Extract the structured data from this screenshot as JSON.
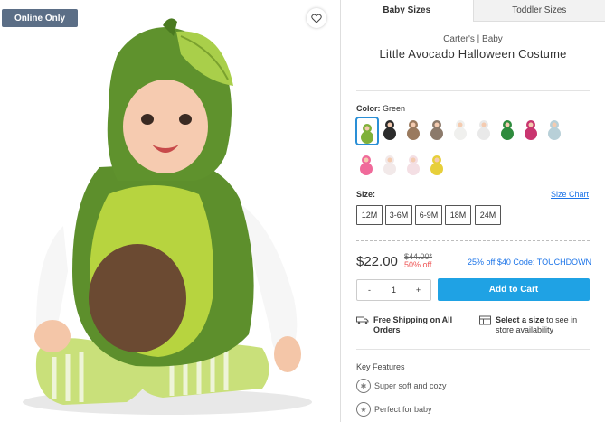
{
  "image": {
    "badge": "Online Only"
  },
  "tabs": [
    {
      "label": "Baby Sizes"
    },
    {
      "label": "Toddler Sizes"
    }
  ],
  "product": {
    "brand": "Carter's | Baby",
    "title": "Little Avocado Halloween Costume"
  },
  "color": {
    "label": "Color:",
    "value": "Green",
    "swatches": [
      {
        "name": "avocado",
        "color": "#7fb13a"
      },
      {
        "name": "penguin",
        "color": "#2b2b2b"
      },
      {
        "name": "monkey",
        "color": "#9a7a5e"
      },
      {
        "name": "sloth",
        "color": "#8c7a6b"
      },
      {
        "name": "chicken",
        "color": "#f0f0ee"
      },
      {
        "name": "cow",
        "color": "#e9e9e9"
      },
      {
        "name": "dinosaur",
        "color": "#2e8b3d"
      },
      {
        "name": "panda-pink",
        "color": "#c9356f"
      },
      {
        "name": "shark",
        "color": "#b8d0d8"
      },
      {
        "name": "flamingo",
        "color": "#f06a9a"
      },
      {
        "name": "bunny",
        "color": "#f2e9e9"
      },
      {
        "name": "unicorn",
        "color": "#f4dfe4"
      },
      {
        "name": "giraffe",
        "color": "#e7cf3a"
      }
    ]
  },
  "size": {
    "label": "Size:",
    "chart_link": "Size Chart",
    "options": [
      "12M",
      "3-6M",
      "6-9M",
      "18M",
      "24M"
    ]
  },
  "price": {
    "current": "$22.00",
    "original": "$44.00*",
    "discount": "50% off",
    "promo": "25% off $40 Code: TOUCHDOWN"
  },
  "cart": {
    "minus": "-",
    "quantity": "1",
    "plus": "+",
    "add_label": "Add to Cart"
  },
  "shipping": {
    "free_label": "Free Shipping on All Orders",
    "store_bold": "Select a size",
    "store_rest": "to see in store availability"
  },
  "features": {
    "heading": "Key Features",
    "items": [
      "Super soft and cozy",
      "Perfect for baby"
    ]
  }
}
